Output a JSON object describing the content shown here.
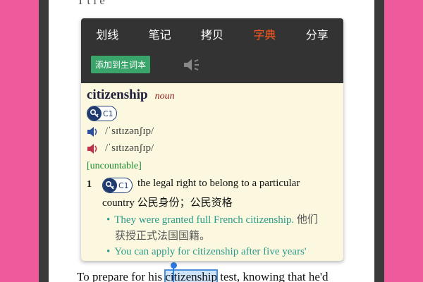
{
  "book": {
    "top_lines": [
      "               T     t       i    e",
      "",
      "",
      "",
      "",
      "",
      ""
    ],
    "bottom_before": "To prepare for his ",
    "bottom_selected": "citizenship",
    "bottom_after": " test, knowing that he'd"
  },
  "menu": {
    "items": [
      "划线",
      "笔记",
      "拷贝",
      "字典",
      "分享"
    ],
    "active_index": 3
  },
  "actions": {
    "add_label": "添加到生词本"
  },
  "dict": {
    "headword": "citizenship",
    "pos": "noun",
    "level": "C1",
    "pron_uk": "/ˈsɪtɪzənʃɪp/",
    "pron_us": "/ˈsɪtɪzənʃɪp/",
    "grammar": "[uncountable]",
    "sense_num": "1",
    "sense_level": "C1",
    "def_en_1": "the legal right to belong to a particular",
    "def_en_2": "country",
    "def_cn": "公民身份；公民资格",
    "ex1_en": "They were granted full French citizenship.",
    "ex1_cn": "他们",
    "ex1_cn2": "获授正式法国国籍。",
    "ex2_en": "You can apply for citizenship after five years'"
  },
  "colors": {
    "background": "#ee5a9c",
    "menu_active": "#ff5a1f",
    "add_button": "#3aa56b",
    "dict_bg": "#fbf8df",
    "example": "#2a9a8a",
    "grammar": "#1c8a2c",
    "selection": "#2d7ae0"
  }
}
